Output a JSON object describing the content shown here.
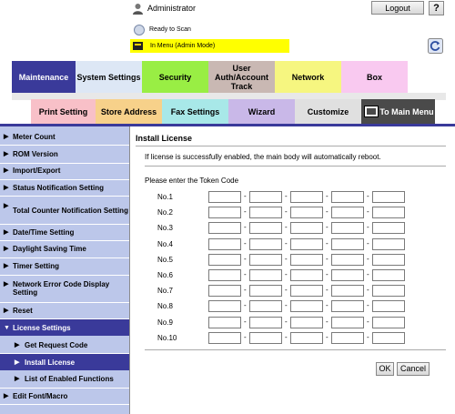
{
  "header": {
    "user_label": "Administrator",
    "logout_label": "Logout",
    "help_label": "?",
    "status_text": "Ready to Scan",
    "mode_text": "In Menu (Admin Mode)"
  },
  "tabs_row1": [
    {
      "label": "Maintenance",
      "color": "#3a3a9a"
    },
    {
      "label": "System Settings",
      "color": "#dde7f5"
    },
    {
      "label": "Security",
      "color": "#99ee44"
    },
    {
      "label": "User Auth/Account Track",
      "color": "#c9b8b3"
    },
    {
      "label": "Network",
      "color": "#f6f680"
    },
    {
      "label": "Box",
      "color": "#f9c9f0"
    }
  ],
  "tabs_row2": [
    {
      "label": "Print Setting",
      "color": "#f8c0c8"
    },
    {
      "label": "Store Address",
      "color": "#f7d18a"
    },
    {
      "label": "Fax Settings",
      "color": "#a8e8e8"
    },
    {
      "label": "Wizard",
      "color": "#c9b8e8"
    },
    {
      "label": "Customize",
      "color": "#e0e0e0"
    },
    {
      "label": "To Main Menu",
      "color": "#4a4a4a"
    }
  ],
  "sidebar": {
    "items": [
      {
        "label": "Meter Count"
      },
      {
        "label": "ROM Version"
      },
      {
        "label": "Import/Export"
      },
      {
        "label": "Status Notification Setting"
      },
      {
        "label": "Total Counter Notification Setting"
      },
      {
        "label": "Date/Time Setting"
      },
      {
        "label": "Daylight Saving Time"
      },
      {
        "label": "Timer Setting"
      },
      {
        "label": "Network Error Code Display Setting"
      },
      {
        "label": "Reset"
      },
      {
        "label": "License Settings"
      },
      {
        "label": "Get Request Code"
      },
      {
        "label": "Install License"
      },
      {
        "label": "List of Enabled Functions"
      },
      {
        "label": "Edit Font/Macro"
      }
    ]
  },
  "main": {
    "title": "Install License",
    "info": "If license is successfully enabled, the main body will automatically reboot.",
    "prompt": "Please enter the Token Code",
    "rows": [
      "No.1",
      "No.2",
      "No.3",
      "No.4",
      "No.5",
      "No.6",
      "No.7",
      "No.8",
      "No.9",
      "No.10"
    ],
    "ok_label": "OK",
    "cancel_label": "Cancel"
  },
  "colors": {
    "sidebar_bg": "#bcc7ea",
    "sidebar_selected": "#3a3a9a",
    "mode_bar": "#ffff00"
  }
}
